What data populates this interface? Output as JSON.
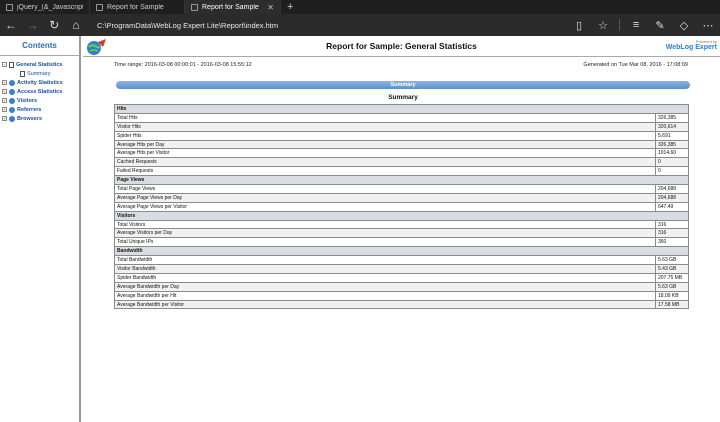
{
  "browser": {
    "tabs": [
      {
        "label": "jQuery_(&_Javascript).pdf",
        "active": false
      },
      {
        "label": "Report for Sample",
        "active": false
      },
      {
        "label": "Report for Sample",
        "active": true
      }
    ],
    "address": "C:\\ProgramData\\WebLog Expert Lite\\Report\\index.htm"
  },
  "sidebar": {
    "title": "Contents",
    "items": [
      {
        "label": "General Statistics",
        "expander": "−"
      },
      {
        "label": "Summary"
      },
      {
        "label": "Activity Statistics",
        "expander": "+"
      },
      {
        "label": "Access Statistics",
        "expander": "+"
      },
      {
        "label": "Visitors",
        "expander": "+"
      },
      {
        "label": "Referrers",
        "expander": "+"
      },
      {
        "label": "Browsers",
        "expander": "+"
      }
    ]
  },
  "report": {
    "title": "Report for Sample: General Statistics",
    "powered_by": "Powered by",
    "brand": "WebLog Expert",
    "time_range": "Time range: 2016-03-08 00:00:01 - 2016-03-08 15:55:12",
    "generated": "Generated on Tue Mar 08, 2016 - 17:08:09",
    "summary_bar": "Summary",
    "summary_title": "Summary",
    "sections": [
      {
        "name": "Hits",
        "rows": [
          [
            "Total Hits",
            "326,385"
          ],
          [
            "Visitor Hits",
            "320,614"
          ],
          [
            "Spider Hits",
            "5,691"
          ],
          [
            "Average Hits per Day",
            "326,385"
          ],
          [
            "Average Hits per Visitor",
            "1014.60"
          ],
          [
            "Cached Requests",
            "0"
          ],
          [
            "Failed Requests",
            "0"
          ]
        ]
      },
      {
        "name": "Page Views",
        "rows": [
          [
            "Total Page Views",
            "204,688"
          ],
          [
            "Average Page Views per Day",
            "204,688"
          ],
          [
            "Average Page Views per Visitor",
            "647.49"
          ]
        ]
      },
      {
        "name": "Visitors",
        "rows": [
          [
            "Total Visitors",
            "316"
          ],
          [
            "Average Visitors per Day",
            "316"
          ],
          [
            "Total Unique IPs",
            "360"
          ]
        ]
      },
      {
        "name": "Bandwidth",
        "rows": [
          [
            "Total Bandwidth",
            "5.63 GB"
          ],
          [
            "Visitor Bandwidth",
            "5.43 GB"
          ],
          [
            "Spider Bandwidth",
            "207.75 MB"
          ],
          [
            "Average Bandwidth per Day",
            "5.63 GB"
          ],
          [
            "Average Bandwidth per Hit",
            "18.09 KB"
          ],
          [
            "Average Bandwidth per Visitor",
            "17.58 MB"
          ]
        ]
      }
    ]
  }
}
